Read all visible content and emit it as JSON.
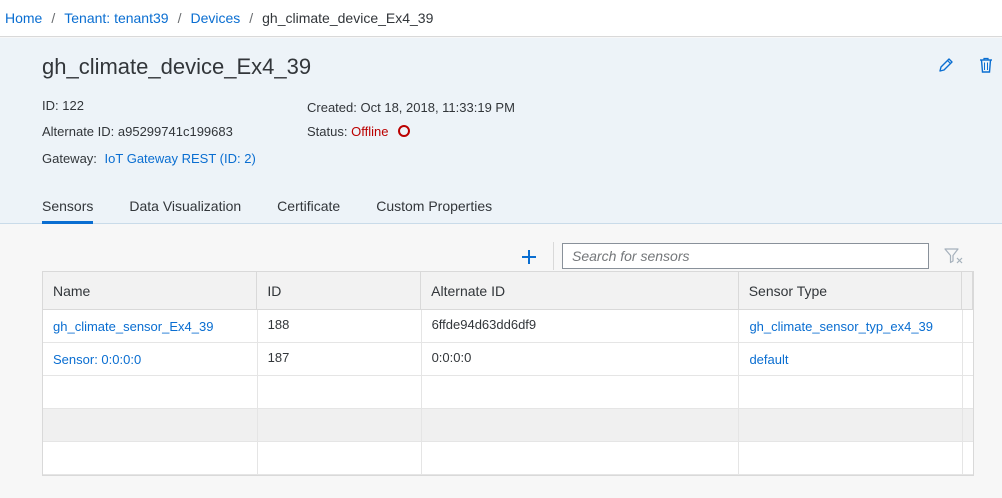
{
  "breadcrumb": {
    "home": "Home",
    "tenant": "Tenant: tenant39",
    "devices": "Devices",
    "current": "gh_climate_device_Ex4_39",
    "separator": "/"
  },
  "device": {
    "title": "gh_climate_device_Ex4_39",
    "id_label": "ID:",
    "id_value": "122",
    "alt_id_label": "Alternate ID:",
    "alt_id_value": "a95299741c199683",
    "gateway_label": "Gateway:",
    "gateway_value": "IoT Gateway REST (ID: 2)",
    "created_label": "Created:",
    "created_value": "Oct 18, 2018, 11:33:19 PM",
    "status_label": "Status:",
    "status_value": "Offline"
  },
  "tabs": [
    {
      "label": "Sensors",
      "active": true
    },
    {
      "label": "Data Visualization",
      "active": false
    },
    {
      "label": "Certificate",
      "active": false
    },
    {
      "label": "Custom Properties",
      "active": false
    }
  ],
  "toolbar": {
    "add_icon": "plus-icon",
    "search_placeholder": "Search for sensors",
    "filter_icon": "clear-filter-icon"
  },
  "table": {
    "columns": [
      "Name",
      "ID",
      "Alternate ID",
      "Sensor Type"
    ],
    "rows": [
      [
        "gh_climate_sensor_Ex4_39",
        "188",
        "6ffde94d63dd6df9",
        "gh_climate_sensor_typ_ex4_39"
      ],
      [
        "Sensor: 0:0:0:0",
        "187",
        "0:0:0:0",
        "default"
      ]
    ]
  },
  "colors": {
    "link": "#0a6ed1",
    "offline": "#bb0000",
    "header_bg": "#edf3f8"
  }
}
